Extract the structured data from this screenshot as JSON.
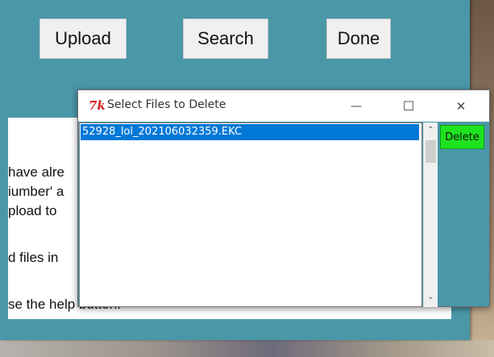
{
  "toolbar": {
    "upload_label": "Upload",
    "search_label": "Search",
    "done_label": "Done"
  },
  "main_text": {
    "lines": [
      "have alre",
      "iumber' a",
      "pload to",
      "d files in",
      "se the help button."
    ]
  },
  "dialog": {
    "title": "Select Files to Delete",
    "app_icon": "tk-feather-icon",
    "files": [
      "52928_lol_202106032359.EKC"
    ],
    "selected_index": 0,
    "delete_label": "Delete",
    "minimize_glyph": "—",
    "maximize_glyph": "☐",
    "close_glyph": "✕",
    "scroll_up_glyph": "⌃",
    "scroll_down_glyph": "⌄"
  },
  "colors": {
    "app_bg": "#4a97a8",
    "selection": "#0078d7",
    "delete_bg": "#1ee31e"
  }
}
